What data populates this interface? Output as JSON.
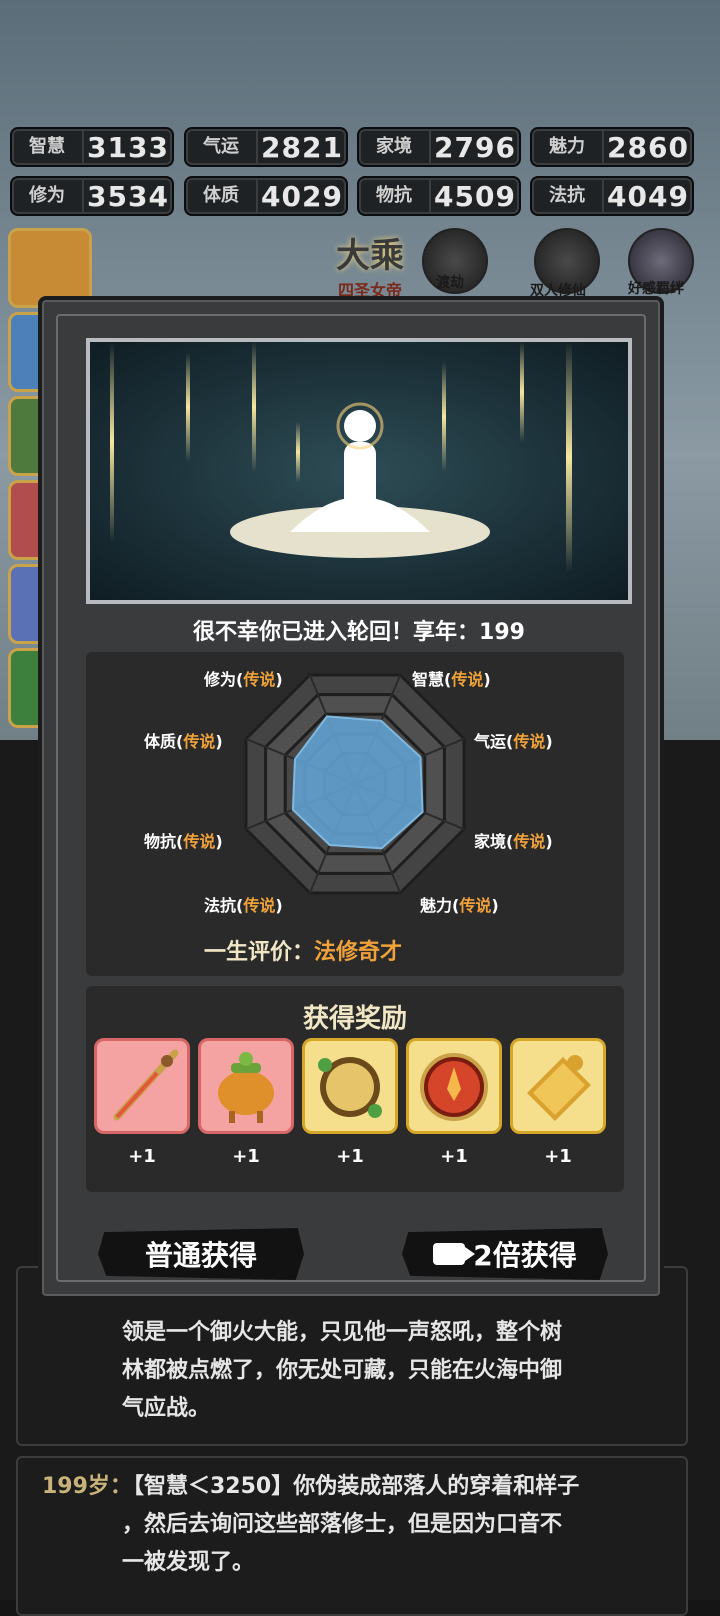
{
  "stats": [
    {
      "label": "智慧",
      "value": "3133"
    },
    {
      "label": "气运",
      "value": "2821"
    },
    {
      "label": "家境",
      "value": "2796"
    },
    {
      "label": "魅力",
      "value": "2860"
    },
    {
      "label": "修为",
      "value": "3534"
    },
    {
      "label": "体质",
      "value": "4029"
    },
    {
      "label": "物抗",
      "value": "4509"
    },
    {
      "label": "法抗",
      "value": "4049"
    }
  ],
  "realm": {
    "name": "大乘",
    "title": "四圣女帝"
  },
  "top_icons": [
    {
      "label": "渡劫",
      "icon": "lock-icon"
    },
    {
      "label": "双人修仙",
      "icon": "sword-cloud-icon"
    },
    {
      "label": "好感羁绊",
      "icon": "companion-portrait-icon"
    }
  ],
  "dialog": {
    "fate_text": "很不幸你已进入轮回！享年：199",
    "radar_labels": [
      {
        "name": "修为",
        "rank": "传说"
      },
      {
        "name": "智慧",
        "rank": "传说"
      },
      {
        "name": "体质",
        "rank": "传说"
      },
      {
        "name": "气运",
        "rank": "传说"
      },
      {
        "name": "物抗",
        "rank": "传说"
      },
      {
        "name": "家境",
        "rank": "传说"
      },
      {
        "name": "法抗",
        "rank": "传说"
      },
      {
        "name": "魅力",
        "rank": "传说"
      }
    ],
    "radar_values": [
      0.62,
      0.58,
      0.55,
      0.6,
      0.57,
      0.62,
      0.56,
      0.59
    ],
    "evaluation_label": "一生评价：",
    "evaluation_value": "法修奇才",
    "reward_title": "获得奖励",
    "rewards": [
      {
        "name": "flame-sword",
        "count": "+1",
        "rarity": "red"
      },
      {
        "name": "jade-cauldron",
        "count": "+1",
        "rarity": "red"
      },
      {
        "name": "jade-mirror",
        "count": "+1",
        "rarity": "gold"
      },
      {
        "name": "fire-orb",
        "count": "+1",
        "rarity": "gold"
      },
      {
        "name": "gold-token",
        "count": "+1",
        "rarity": "gold"
      }
    ],
    "btn_normal": "普通获得",
    "btn_double": "2倍获得"
  },
  "log": {
    "entry1_lines": [
      "领是一个御火大能，只见他一声怒吼，整个树",
      "林都被点燃了，你无处可藏，只能在火海中御",
      "气应战。"
    ],
    "entry2_age": "199岁：",
    "entry2_lines": [
      "【智慧＜3250】你伪装成部落人的穿着和样子",
      "，然后去询问这些部落修士，但是因为口音不",
      "一被发现了。"
    ]
  }
}
